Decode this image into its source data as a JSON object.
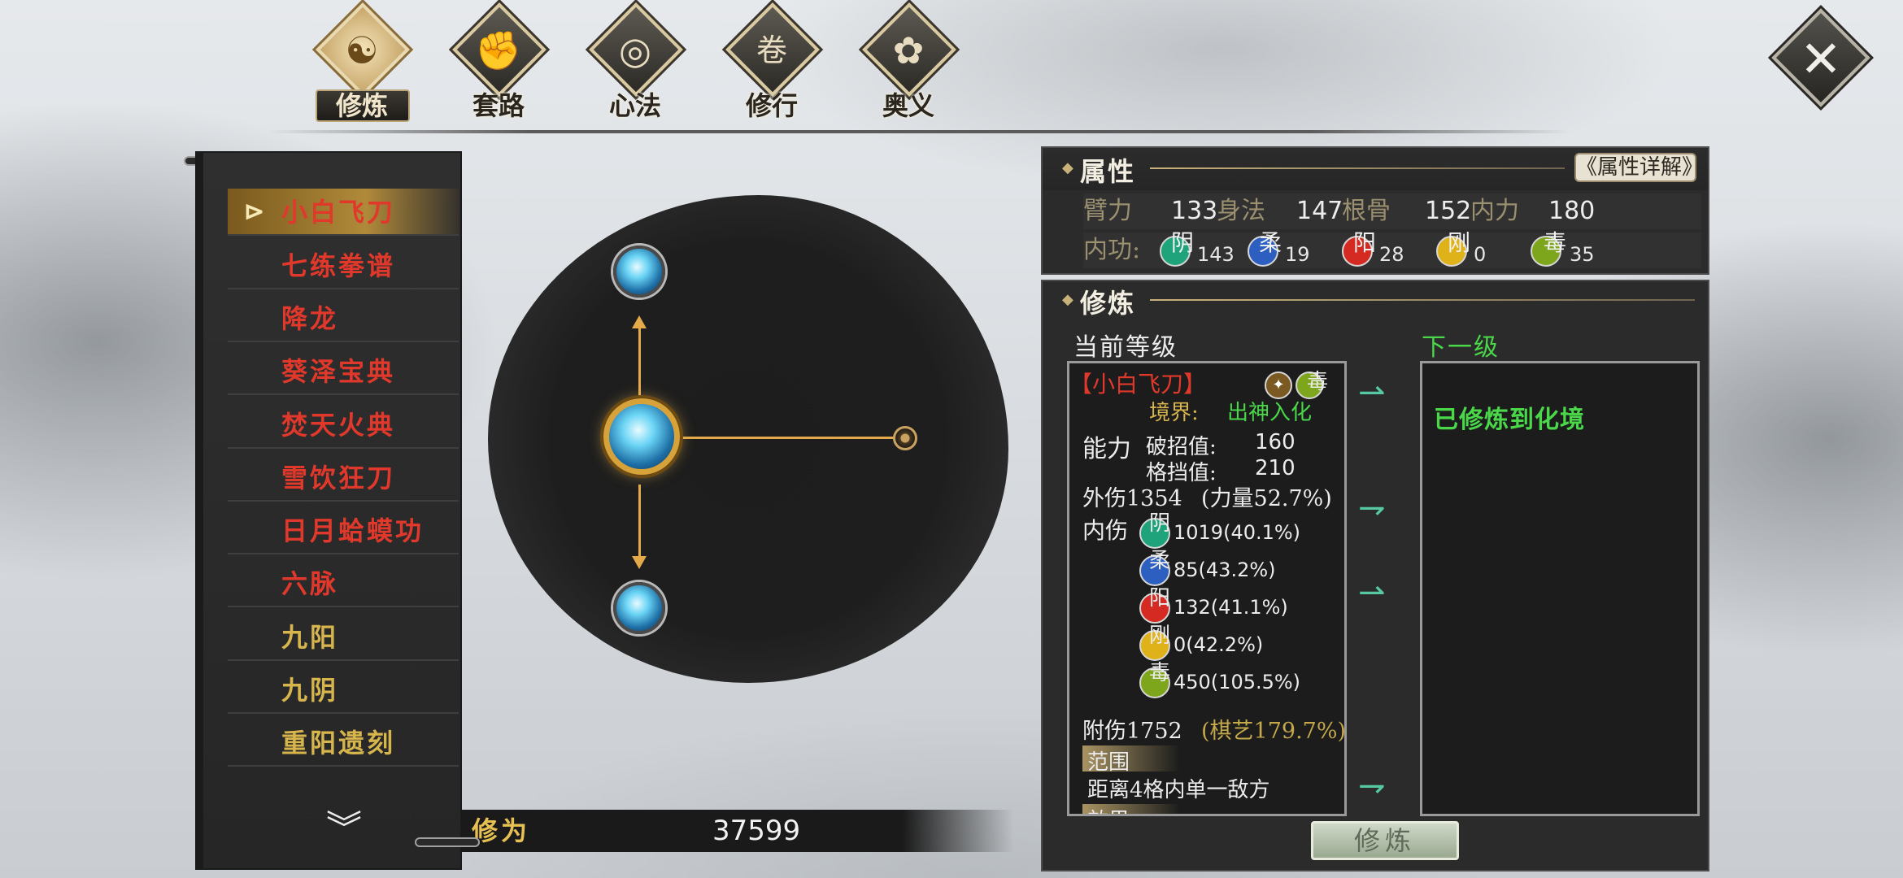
{
  "nav": {
    "tabs": [
      {
        "label": "修炼",
        "icon": "☯"
      },
      {
        "label": "套路",
        "icon": "✊"
      },
      {
        "label": "心法",
        "icon": "◎"
      },
      {
        "label": "修行",
        "icon": "卷"
      },
      {
        "label": "奥义",
        "icon": "✿"
      }
    ],
    "active": "修炼",
    "close_icon": "✕"
  },
  "skill_list": {
    "items": [
      {
        "name": "小白飞刀",
        "color": "#e0392c",
        "selected": true,
        "marker": "⊳"
      },
      {
        "name": "七练拳谱",
        "color": "#e0392c"
      },
      {
        "name": "降龙",
        "color": "#e0392c"
      },
      {
        "name": "葵泽宝典",
        "color": "#e0392c"
      },
      {
        "name": "焚天火典",
        "color": "#e0392c"
      },
      {
        "name": "雪饮狂刀",
        "color": "#e0392c"
      },
      {
        "name": "日月蛤蟆功",
        "color": "#e0392c"
      },
      {
        "name": "六脉",
        "color": "#e0392c"
      },
      {
        "name": "九阳",
        "color": "#d7b54d"
      },
      {
        "name": "九阴",
        "color": "#d7b54d"
      },
      {
        "name": "重阳遗刻",
        "color": "#d7b54d"
      }
    ],
    "scroll_icon": "︾"
  },
  "cultivation_points": {
    "label": "修为",
    "value": "37599"
  },
  "attributes": {
    "title": "属性",
    "detail_button": "《属性详解》",
    "stats": [
      {
        "name": "臂力",
        "value": "133"
      },
      {
        "name": "身法",
        "value": "147"
      },
      {
        "name": "根骨",
        "value": "152"
      },
      {
        "name": "内力",
        "value": "180"
      }
    ],
    "inner_label": "内功:",
    "inner_elements": [
      {
        "char": "阴",
        "value": "143",
        "color": "#1fa37a"
      },
      {
        "char": "柔",
        "value": "19",
        "color": "#2c5fbf"
      },
      {
        "char": "阳",
        "value": "28",
        "color": "#d42a22"
      },
      {
        "char": "刚",
        "value": "0",
        "color": "#e0b21a"
      },
      {
        "char": "毒",
        "value": "35",
        "color": "#7ea61c"
      }
    ]
  },
  "cultivation": {
    "title": "修炼",
    "current_level_title": "当前等级",
    "next_level_title": "下一级",
    "skill_name": "【小白飞刀】",
    "skill_badge": "毒",
    "realm_label": "境界:",
    "realm_value": "出神入化",
    "ability_label": "能力",
    "break_label": "破招值:",
    "break_value": "160",
    "block_label": "格挡值:",
    "block_value": "210",
    "outer_damage": "外伤1354",
    "outer_damage_note": "(力量52.7%)",
    "inner_damage_label": "内伤",
    "inner_damage": [
      {
        "char": "阴",
        "value": "1019(40.1%)",
        "color": "#1fa37a"
      },
      {
        "char": "柔",
        "value": "85(43.2%)",
        "color": "#2c5fbf"
      },
      {
        "char": "阳",
        "value": "132(41.1%)",
        "color": "#d42a22"
      },
      {
        "char": "刚",
        "value": "0(42.2%)",
        "color": "#e0b21a"
      },
      {
        "char": "毒",
        "value": "450(105.5%)",
        "color": "#7ea61c"
      }
    ],
    "extra_damage": "附伤1752",
    "extra_damage_note": "(棋艺179.7%)",
    "range_tag": "范围",
    "range_text": "距离4格内单一敌方",
    "effect_tag_partial": "效果",
    "next_level_text": "已修炼到化境",
    "button_label": "修炼"
  },
  "colors": {
    "accent_gold": "#d7b54d",
    "skill_red": "#e0392c",
    "next_green": "#4ad84a",
    "panel_bg": "#2b2b2b"
  }
}
